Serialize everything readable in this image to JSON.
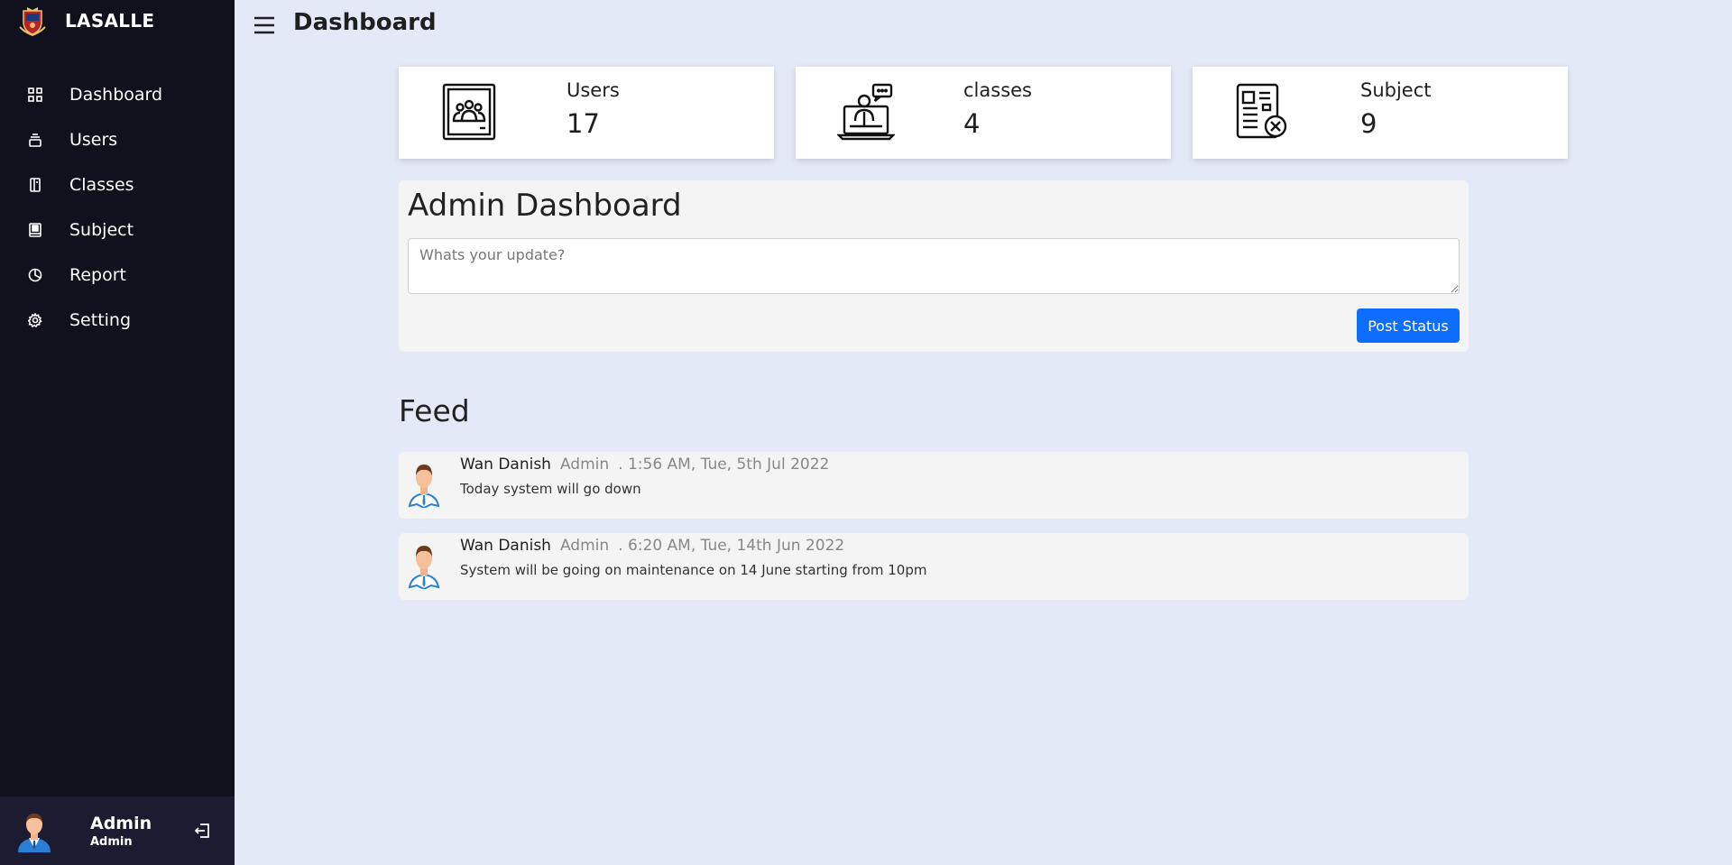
{
  "brand": {
    "name": "LASALLE"
  },
  "sidebar": {
    "items": [
      {
        "label": "Dashboard",
        "icon": "grid-icon"
      },
      {
        "label": "Users",
        "icon": "users-icon"
      },
      {
        "label": "Classes",
        "icon": "classes-icon"
      },
      {
        "label": "Subject",
        "icon": "book-icon"
      },
      {
        "label": "Report",
        "icon": "pie-chart-icon"
      },
      {
        "label": "Setting",
        "icon": "gear-icon"
      }
    ],
    "profile": {
      "name": "Admin",
      "role": "Admin"
    }
  },
  "header": {
    "title": "Dashboard"
  },
  "stats": [
    {
      "label": "Users",
      "value": "17",
      "icon": "users-frame-icon"
    },
    {
      "label": "classes",
      "value": "4",
      "icon": "online-class-icon"
    },
    {
      "label": "Subject",
      "value": "9",
      "icon": "document-icon"
    }
  ],
  "admin": {
    "title": "Admin Dashboard",
    "placeholder": "Whats your update?",
    "post_label": "Post Status"
  },
  "feed": {
    "title": "Feed",
    "items": [
      {
        "name": "Wan Danish",
        "role": "Admin",
        "time": ". 1:56 AM, Tue, 5th Jul 2022",
        "text": "Today system will go down"
      },
      {
        "name": "Wan Danish",
        "role": "Admin",
        "time": ". 6:20 AM, Tue, 14th Jun 2022",
        "text": "System will be going on maintenance on 14 June starting from 10pm"
      }
    ]
  },
  "colors": {
    "sidebar": "#11101d",
    "background": "#e4e9f7",
    "accent": "#0d6efd"
  }
}
